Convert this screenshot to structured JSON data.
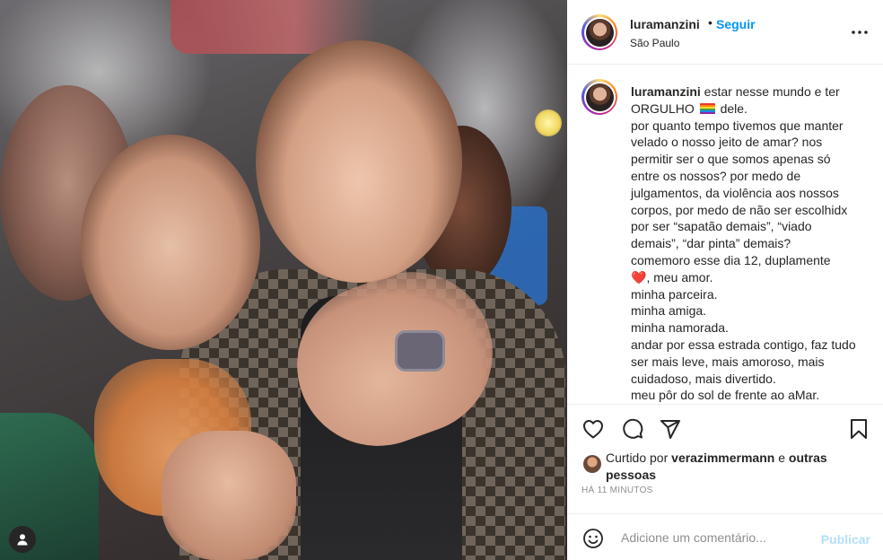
{
  "post": {
    "username": "luramanzini",
    "separator": "•",
    "follow_label": "Seguir",
    "location": "São Paulo",
    "more_icon": "more-horizontal-icon"
  },
  "caption": {
    "username": "luramanzini",
    "line1": " estar nesse mundo e ter ORGULHO ",
    "line1b": " dele.\npor quanto tempo tivemos que manter velado o nosso jeito de amar? nos permitir ser o que somos apenas só entre os nossos? por medo de julgamentos, da violência aos nossos corpos, por medo de não ser escolhidx por ser “sapatão demais”, “viado demais”, “dar pinta” demais?\ncomemoro esse dia 12, duplamente\n",
    "heart": "❤️",
    "line2": ", meu amor.\nminha parceira.\nminha amiga.\nminha namorada.\nandar por essa estrada contigo, faz tudo ser mais leve, mais amoroso, mais cuidadoso, mais divertido.\nmeu pôr do sol de frente ao aMar."
  },
  "actions": {
    "like_icon": "heart-icon",
    "comment_icon": "comment-icon",
    "share_icon": "send-icon",
    "save_icon": "bookmark-icon"
  },
  "likes": {
    "prefix": "Curtido por ",
    "user": "verazimmermann",
    "middle": " e ",
    "others": "outras pessoas"
  },
  "time_ago": "HÁ 11 MINUTOS",
  "comment": {
    "placeholder": "Adicione um comentário...",
    "publish_label": "Publicar",
    "emoji_icon": "emoji-smile-icon"
  },
  "colors": {
    "link": "#0095f6",
    "publish_disabled": "#b2dffc",
    "muted": "#8e8e8e",
    "text": "#262626"
  }
}
